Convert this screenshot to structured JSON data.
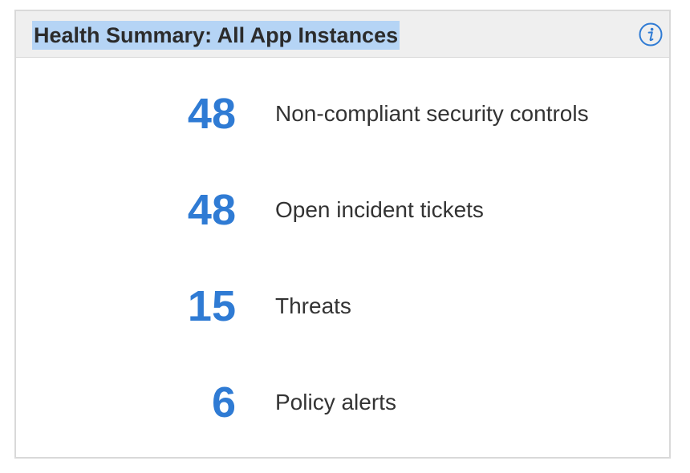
{
  "widget": {
    "title": "Health Summary: All App Instances",
    "info_icon": "info-icon",
    "accent_color": "#2f7bd4",
    "title_highlight_color": "#b5d4f5"
  },
  "metrics": [
    {
      "value": "48",
      "label": "Non-compliant security controls"
    },
    {
      "value": "48",
      "label": "Open incident tickets"
    },
    {
      "value": "15",
      "label": "Threats"
    },
    {
      "value": "6",
      "label": "Policy alerts"
    }
  ]
}
